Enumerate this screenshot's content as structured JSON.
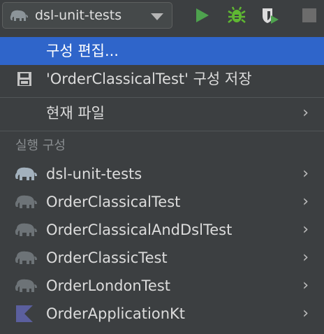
{
  "toolbar": {
    "config_name": "dsl-unit-tests",
    "run_icon": "run-icon",
    "debug_icon": "debug-bug-icon",
    "coverage_icon": "run-with-coverage-icon",
    "stop_icon": "stop-icon",
    "colors": {
      "run": "#4ea24e",
      "debug": "#5fb832",
      "stop": "#6c6c6c"
    }
  },
  "menu": {
    "edit_configs": "구성 편집...",
    "save_config": "'OrderClassicalTest' 구성 저장",
    "current_file": "현재 파일",
    "section_title": "실행 구성",
    "selected_color": "#2f65ca",
    "configs": [
      {
        "label": "dsl-unit-tests",
        "icon": "elephant-icon",
        "bright": true
      },
      {
        "label": "OrderClassicalTest",
        "icon": "elephant-icon",
        "bright": false
      },
      {
        "label": "OrderClassicalAndDslTest",
        "icon": "elephant-icon",
        "bright": false
      },
      {
        "label": "OrderClassicTest",
        "icon": "elephant-icon",
        "bright": false
      },
      {
        "label": "OrderLondonTest",
        "icon": "elephant-icon",
        "bright": false
      },
      {
        "label": "OrderApplicationKt",
        "icon": "kotlin-icon",
        "bright": true
      }
    ]
  }
}
